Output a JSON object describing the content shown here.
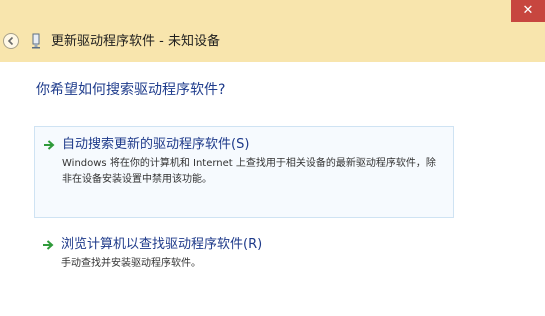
{
  "window": {
    "title": "更新驱动程序软件 - 未知设备",
    "close_glyph": "✕",
    "titlebar_color": "#f8e5ad",
    "close_color": "#c7463f"
  },
  "question": "你希望如何搜索驱动程序软件?",
  "options": [
    {
      "icon": "green-arrow-icon",
      "title": "自动搜索更新的驱动程序软件(S)",
      "description": "Windows 将在你的计算机和 Internet 上查找用于相关设备的最新驱动程序软件，除非在设备安装设置中禁用该功能。"
    },
    {
      "icon": "green-arrow-icon",
      "title": "浏览计算机以查找驱动程序软件(R)",
      "description": "手动查找并安装驱动程序软件。"
    }
  ],
  "colors": {
    "accent_text": "#1f3c8c",
    "arrow_green": "#2f9a3a",
    "selected_border": "#cfe3f3"
  }
}
